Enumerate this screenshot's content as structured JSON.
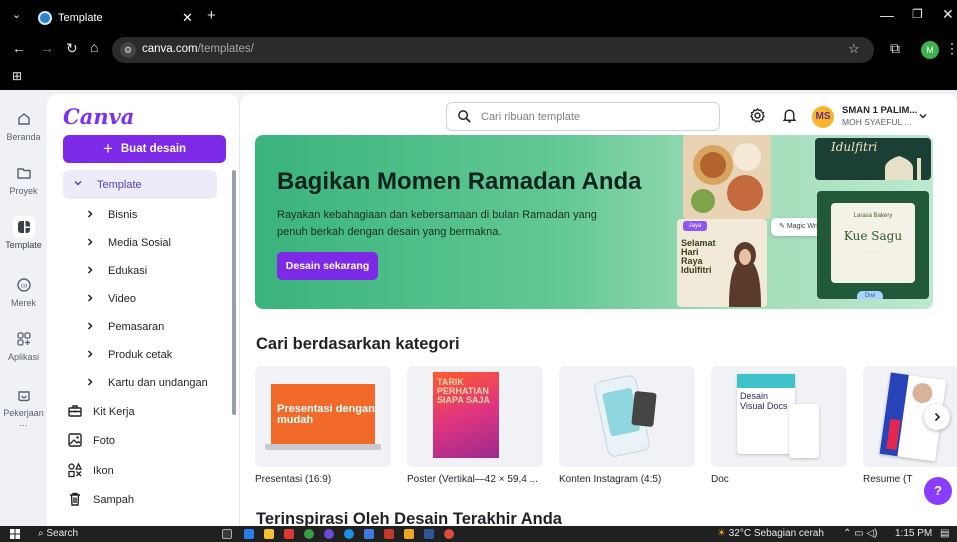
{
  "browser": {
    "tab_title": "Template",
    "url_host": "canva.com",
    "url_path": "/templates/",
    "profile_initial": "M"
  },
  "rail": [
    {
      "label": "Beranda",
      "icon": "home-icon"
    },
    {
      "label": "Proyek",
      "icon": "folder-icon"
    },
    {
      "label": "Template",
      "icon": "template-icon"
    },
    {
      "label": "Merek",
      "icon": "brand-icon"
    },
    {
      "label": "Aplikasi",
      "icon": "apps-icon"
    },
    {
      "label": "Pekerjaan ...",
      "icon": "work-icon"
    }
  ],
  "sidebar": {
    "logo": "Canva",
    "create_label": "Buat desain",
    "template_label": "Template",
    "sub_items": [
      "Bisnis",
      "Media Sosial",
      "Edukasi",
      "Video",
      "Pemasaran",
      "Produk cetak",
      "Kartu dan undangan"
    ],
    "items": [
      {
        "label": "Kit Kerja",
        "icon": "briefcase-icon"
      },
      {
        "label": "Foto",
        "icon": "photo-icon"
      },
      {
        "label": "Ikon",
        "icon": "shapes-icon"
      },
      {
        "label": "Sampah",
        "icon": "trash-icon"
      }
    ]
  },
  "header": {
    "search_placeholder": "Cari ribuan template",
    "avatar_initials": "MS",
    "account_name": "SMAN 1 PALIM...",
    "account_sub": "MOH SYAEFUL ..."
  },
  "banner": {
    "title": "Bagikan Momen Ramadan Anda",
    "text": "Rayakan kebahagiaan dan kebersamaan di bulan Ramadan yang penuh berkah dengan desain yang bermakna.",
    "button": "Desain sekarang",
    "art": {
      "poster_a_tag": "Jaya",
      "poster_a_title": "Selamat Hari Raya Idulfitri",
      "magic_write": "Magic Write",
      "poster_b_title": "Idulfitri",
      "poster_c_small": "Larasa Bakery",
      "poster_c_title": "Kue Sagu",
      "poster_c_tag": "Dwi"
    }
  },
  "categories": {
    "title": "Cari berdasarkan kategori",
    "items": [
      {
        "label": "Presentasi (16:9)",
        "thumb_text": "Presentasi dengan mudah"
      },
      {
        "label": "Poster (Vertikal—42 × 59,4 ...",
        "thumb_text": "TARIK PERHATIAN SIAPA SAJA"
      },
      {
        "label": "Konten Instagram (4:5)",
        "thumb_text": ""
      },
      {
        "label": "Doc",
        "thumb_text": "Desain Visual Docs"
      },
      {
        "label": "Resume (T",
        "thumb_text": ""
      }
    ]
  },
  "recent_title": "Terinspirasi Oleh Desain Terakhir Anda",
  "taskbar": {
    "search": "Search",
    "weather": "32°C  Sebagian cerah",
    "time": "1:15 PM"
  },
  "colors": {
    "brand_purple": "#7d2ae8",
    "banner_green": "#3ab37d"
  }
}
